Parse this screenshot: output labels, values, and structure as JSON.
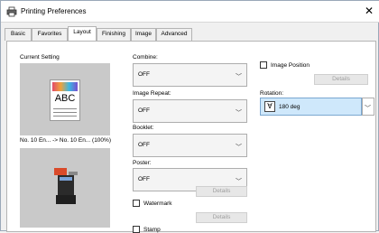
{
  "window": {
    "title": "Printing Preferences",
    "close_glyph": "✕"
  },
  "tabs": [
    {
      "label": "Basic"
    },
    {
      "label": "Favorites"
    },
    {
      "label": "Layout"
    },
    {
      "label": "Finishing"
    },
    {
      "label": "Image"
    },
    {
      "label": "Advanced"
    }
  ],
  "current_setting": {
    "label": "Current Setting",
    "doc_text": "ABC",
    "paper_info": "No. 10 En... -> No. 10 En... (100%)"
  },
  "combine": {
    "label": "Combine:",
    "value": "OFF"
  },
  "image_repeat": {
    "label": "Image Repeat:",
    "value": "OFF"
  },
  "booklet": {
    "label": "Booklet:",
    "value": "OFF"
  },
  "poster": {
    "label": "Poster:",
    "value": "OFF"
  },
  "details_label": "Details",
  "watermark": {
    "label": "Watermark",
    "checked": false
  },
  "stamp": {
    "label": "Stamp",
    "checked": false
  },
  "image_position": {
    "label": "Image Position",
    "checked": false
  },
  "rotation": {
    "label": "Rotation:",
    "value": "180 deg",
    "icon_glyph": "∀"
  },
  "colors": {
    "accent": "#cfe8fb",
    "panel": "#ffffff",
    "preview_bg": "#c9c9c9"
  }
}
